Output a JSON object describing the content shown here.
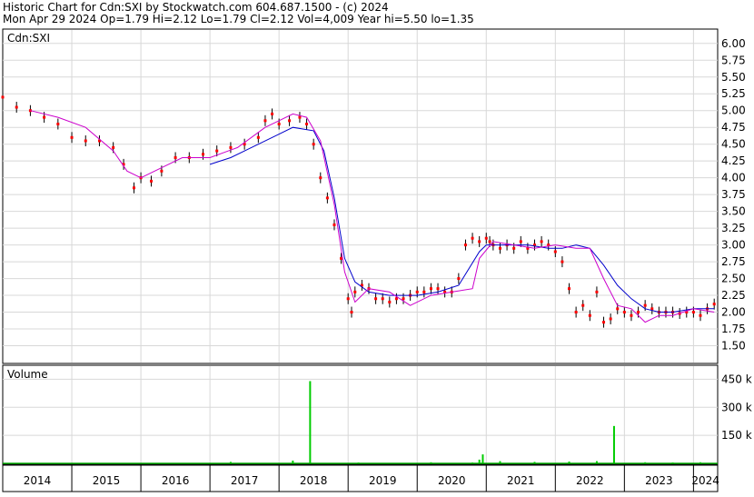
{
  "header": {
    "line1": "Historic Chart for Cdn:SXI by Stockwatch.com 604.687.1500 - (c) 2024",
    "line2": "Mon Apr 29 2024   Op=1.79   Hi=2.12   Lo=1.79   Cl=2.12   Vol=4,009   Year hi=5.50   lo=1.35"
  },
  "chart_data": [
    {
      "type": "line",
      "panel": "price",
      "label": "Cdn:SXI",
      "x_range": [
        2014.0,
        2024.35
      ],
      "ylim": [
        1.25,
        6.2
      ],
      "y_ticks": [
        "6.00",
        "5.75",
        "5.50",
        "5.25",
        "5.00",
        "4.75",
        "4.50",
        "4.25",
        "4.00",
        "3.75",
        "3.50",
        "3.25",
        "3.00",
        "2.75",
        "2.50",
        "2.25",
        "2.00",
        "1.75",
        "1.50"
      ],
      "grid": true,
      "series": [
        {
          "color": "#ff0000",
          "style": "price-points",
          "x": [
            2014.0,
            2014.2,
            2014.4,
            2014.6,
            2014.8,
            2015.0,
            2015.2,
            2015.4,
            2015.6,
            2015.75,
            2015.9,
            2016.0,
            2016.15,
            2016.3,
            2016.5,
            2016.7,
            2016.9,
            2017.1,
            2017.3,
            2017.5,
            2017.7,
            2017.8,
            2017.9,
            2018.0,
            2018.15,
            2018.3,
            2018.4,
            2018.5,
            2018.6,
            2018.7,
            2018.8,
            2018.9,
            2019.0,
            2019.05,
            2019.1,
            2019.2,
            2019.3,
            2019.4,
            2019.5,
            2019.6,
            2019.7,
            2019.8,
            2019.9,
            2020.0,
            2020.1,
            2020.2,
            2020.3,
            2020.4,
            2020.5,
            2020.6,
            2020.7,
            2020.8,
            2020.9,
            2021.0,
            2021.05,
            2021.1,
            2021.2,
            2021.3,
            2021.4,
            2021.5,
            2021.6,
            2021.7,
            2021.8,
            2021.9,
            2022.0,
            2022.1,
            2022.2,
            2022.3,
            2022.4,
            2022.5,
            2022.6,
            2022.7,
            2022.8,
            2022.9,
            2023.0,
            2023.1,
            2023.2,
            2023.3,
            2023.4,
            2023.5,
            2023.6,
            2023.7,
            2023.8,
            2023.9,
            2024.0,
            2024.1,
            2024.2,
            2024.3
          ],
          "values": [
            5.2,
            5.05,
            5.0,
            4.9,
            4.8,
            4.6,
            4.55,
            4.55,
            4.45,
            4.2,
            3.85,
            4.0,
            3.95,
            4.1,
            4.3,
            4.3,
            4.35,
            4.4,
            4.45,
            4.5,
            4.6,
            4.85,
            4.95,
            4.8,
            4.85,
            4.9,
            4.8,
            4.5,
            4.0,
            3.7,
            3.3,
            2.8,
            2.2,
            2.0,
            2.3,
            2.4,
            2.35,
            2.2,
            2.2,
            2.15,
            2.2,
            2.2,
            2.25,
            2.3,
            2.3,
            2.35,
            2.35,
            2.3,
            2.3,
            2.5,
            3.0,
            3.1,
            3.05,
            3.1,
            3.05,
            3.0,
            2.95,
            3.0,
            2.95,
            3.05,
            2.95,
            3.0,
            3.05,
            3.0,
            2.9,
            2.75,
            2.35,
            2.0,
            2.1,
            1.95,
            2.3,
            1.85,
            1.9,
            2.05,
            2.0,
            1.95,
            2.0,
            2.1,
            2.05,
            2.0,
            2.0,
            2.0,
            1.98,
            2.0,
            2.0,
            1.95,
            2.05,
            2.12
          ]
        },
        {
          "color": "#0000cc",
          "style": "moving-average",
          "x": [
            2017.0,
            2017.3,
            2017.6,
            2017.9,
            2018.2,
            2018.5,
            2018.65,
            2018.8,
            2018.95,
            2019.1,
            2019.3,
            2019.6,
            2020.0,
            2020.3,
            2020.6,
            2020.9,
            2021.0,
            2021.3,
            2021.6,
            2021.9,
            2022.1,
            2022.3,
            2022.5,
            2022.7,
            2022.9,
            2023.1,
            2023.3,
            2023.5,
            2023.7,
            2024.0,
            2024.3
          ],
          "values": [
            4.2,
            4.3,
            4.45,
            4.6,
            4.75,
            4.7,
            4.4,
            3.7,
            2.8,
            2.45,
            2.3,
            2.25,
            2.25,
            2.3,
            2.4,
            2.9,
            3.0,
            3.0,
            3.0,
            2.95,
            2.95,
            3.0,
            2.95,
            2.7,
            2.4,
            2.2,
            2.05,
            2.0,
            2.0,
            2.05,
            2.05
          ]
        },
        {
          "color": "#cc00cc",
          "style": "moving-average",
          "x": [
            2014.4,
            2014.8,
            2015.2,
            2015.6,
            2015.8,
            2016.0,
            2016.3,
            2016.6,
            2017.0,
            2017.4,
            2017.8,
            2018.0,
            2018.2,
            2018.4,
            2018.6,
            2018.8,
            2018.95,
            2019.1,
            2019.3,
            2019.6,
            2019.9,
            2020.2,
            2020.5,
            2020.8,
            2020.9,
            2021.1,
            2021.4,
            2021.7,
            2022.0,
            2022.3,
            2022.5,
            2022.7,
            2022.9,
            2023.1,
            2023.3,
            2023.5,
            2023.7,
            2024.0,
            2024.3
          ],
          "values": [
            5.0,
            4.9,
            4.75,
            4.4,
            4.1,
            4.0,
            4.15,
            4.3,
            4.3,
            4.45,
            4.75,
            4.85,
            4.95,
            4.9,
            4.55,
            3.6,
            2.6,
            2.15,
            2.35,
            2.3,
            2.1,
            2.25,
            2.3,
            2.35,
            2.8,
            3.05,
            3.0,
            2.95,
            3.0,
            2.95,
            2.95,
            2.5,
            2.1,
            2.05,
            1.85,
            1.95,
            1.95,
            2.05,
            2.0
          ]
        }
      ]
    },
    {
      "type": "bar",
      "panel": "volume",
      "label": "Volume",
      "ylim": [
        0,
        520
      ],
      "y_ticks": [
        "450 k",
        "300 k",
        "150 k"
      ],
      "x_ticks": [
        "2014",
        "2015",
        "2016",
        "2017",
        "2018",
        "2019",
        "2020",
        "2021",
        "2022",
        "2023",
        "2024"
      ],
      "series": [
        {
          "color": "#00cc00",
          "style": "volume-bars",
          "x": [
            2017.3,
            2018.2,
            2018.45,
            2019.15,
            2020.2,
            2020.8,
            2020.9,
            2020.95,
            2021.2,
            2021.7,
            2022.2,
            2022.6,
            2022.85,
            2023.3,
            2023.7,
            2024.1
          ],
          "values": [
            8,
            15,
            440,
            5,
            6,
            5,
            20,
            48,
            12,
            8,
            10,
            12,
            200,
            6,
            5,
            6
          ]
        }
      ]
    }
  ]
}
